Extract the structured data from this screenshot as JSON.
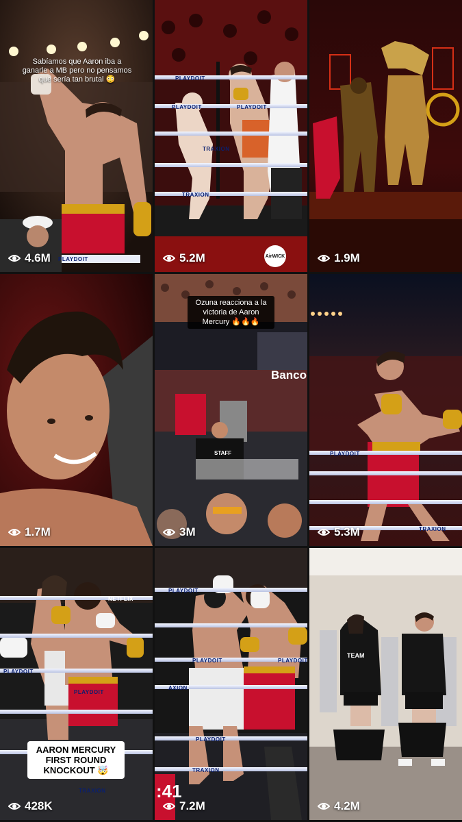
{
  "tiles": [
    {
      "views": "4.6M",
      "caption": "Sabíamos que Aaron iba a ganarle a MB pero no pensamos que sería tan brutal 😳",
      "rope_texts": [
        "PLAYDOIT"
      ]
    },
    {
      "views": "5.2M",
      "rope_texts": [
        "PLAYDOIT",
        "PLAYDOIT",
        "PLAYDOIT",
        "TRAXION",
        "TRAXION"
      ],
      "badge": "AirWICK"
    },
    {
      "views": "1.9M"
    },
    {
      "views": "1.7M"
    },
    {
      "views": "3M",
      "caption": "Ozuna reacciona a la victoria de Aaron Mercury 🔥🔥🔥",
      "brand": "Banco",
      "staff": "STAFF"
    },
    {
      "views": "5.3M",
      "rope_texts": [
        "PLAYDOIT",
        "TRAXION"
      ]
    },
    {
      "views": "428K",
      "caption": "AARON MERCURY FIRST ROUND KNOCKOUT 🤯",
      "rope_texts": [
        "PLAYDOIT",
        "PLAYDOIT",
        "TRAXION",
        "NETFLIX"
      ]
    },
    {
      "views": "7.2M",
      "timer": ":41",
      "rope_texts": [
        "PLAYDOIT",
        "PLAYDOIT",
        "PLAYDOIT",
        "AXION",
        "TRAXION",
        "PLAYDOIT"
      ]
    },
    {
      "views": "4.2M",
      "shirt_text": "TEAM"
    }
  ],
  "colors": {
    "overlay_text": "#ffffff",
    "red_trunks": "#c8102e",
    "gold_trim": "#d4a017",
    "ring_rope": "#e8ecf8"
  },
  "icons": {
    "views": "eye-icon"
  }
}
